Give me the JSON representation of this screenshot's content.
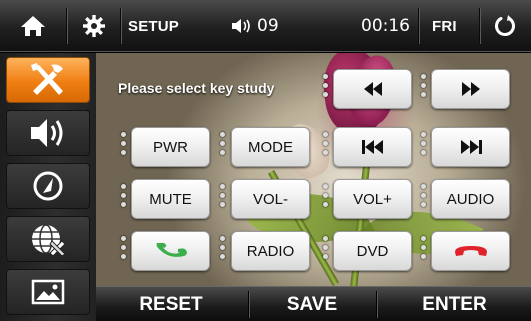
{
  "topbar": {
    "home_icon": "home-icon",
    "settings_icon": "gear-icon",
    "title": "SETUP",
    "volume_icon": "speaker-icon",
    "volume_level": "09",
    "time": "00:16",
    "day": "FRI",
    "back_icon": "return-icon"
  },
  "sidebar": {
    "items": [
      {
        "name": "tools",
        "icon": "tools-icon",
        "active": true
      },
      {
        "name": "sound",
        "icon": "speaker-icon",
        "active": false
      },
      {
        "name": "steering",
        "icon": "gauge-icon",
        "active": false
      },
      {
        "name": "navigation",
        "icon": "globe-tools-icon",
        "active": false
      },
      {
        "name": "picture",
        "icon": "picture-icon",
        "active": false
      }
    ]
  },
  "main": {
    "prompt": "Please select key study",
    "keys": {
      "rewind": {
        "icon": "rewind-icon"
      },
      "fast_forward": {
        "icon": "fast-forward-icon"
      },
      "pwr": "PWR",
      "mode": "MODE",
      "prev": {
        "icon": "previous-track-icon"
      },
      "next": {
        "icon": "next-track-icon"
      },
      "mute": "MUTE",
      "vol_down": "VOL-",
      "vol_up": "VOL+",
      "audio": "AUDIO",
      "call": {
        "icon": "phone-answer-icon",
        "color": "#3cae4a"
      },
      "radio": "RADIO",
      "dvd": "DVD",
      "hangup": {
        "icon": "phone-hangup-icon",
        "color": "#e0222b"
      }
    },
    "active_color": "#f07e12"
  },
  "bottombar": {
    "reset": "RESET",
    "save": "SAVE",
    "enter": "ENTER"
  }
}
